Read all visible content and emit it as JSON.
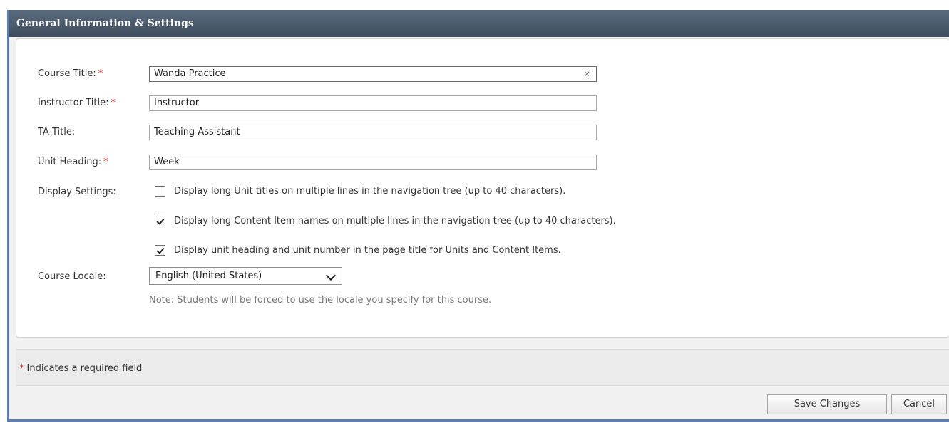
{
  "window": {
    "title": "General Information & Settings"
  },
  "form": {
    "course_title": {
      "label": "Course Title:",
      "value": "Wanda Practice",
      "required_mark": "*",
      "clear_glyph": "×"
    },
    "instructor_title": {
      "label": "Instructor Title:",
      "value": "Instructor",
      "required_mark": "*"
    },
    "ta_title": {
      "label": "TA Title:",
      "value": "Teaching Assistant"
    },
    "unit_heading": {
      "label": "Unit Heading:",
      "value": "Week",
      "required_mark": "*"
    },
    "display_settings": {
      "label": "Display Settings:",
      "options": [
        {
          "text": "Display long Unit titles on multiple lines in the navigation tree (up to 40 characters).",
          "checked": false
        },
        {
          "text": "Display long Content Item names on multiple lines in the navigation tree (up to 40 characters).",
          "checked": true
        },
        {
          "text": "Display unit heading and unit number in the page title for Units and Content Items.",
          "checked": true
        }
      ]
    },
    "course_locale": {
      "label": "Course Locale:",
      "selected": "English (United States)",
      "note": "Note: Students will be forced to use the locale you specify for this course."
    }
  },
  "footer": {
    "required_star": "*",
    "required_text": "Indicates a required field",
    "save_label": "Save Changes",
    "cancel_label": "Cancel"
  },
  "colors": {
    "titlebar": "#3e4d5e",
    "required": "#d12a2a",
    "frame_border": "#5b7fae"
  }
}
